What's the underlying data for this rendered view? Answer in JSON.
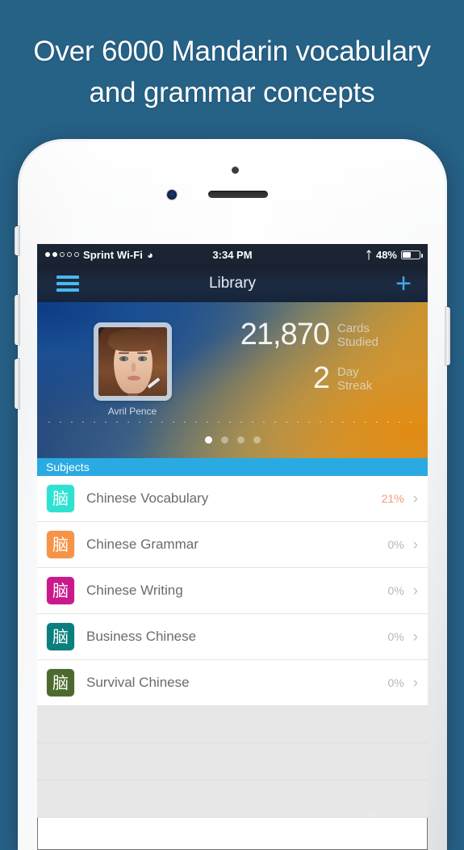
{
  "promo": {
    "line1": "Over 6000 Mandarin vocabulary",
    "line2": "and grammar concepts"
  },
  "status_bar": {
    "carrier": "Sprint Wi-Fi",
    "wifi_icon": "wifi-icon",
    "time": "3:34 PM",
    "bluetooth_icon": "bluetooth-icon",
    "battery_text": "48%",
    "battery_level": 48
  },
  "nav_bar": {
    "menu_icon": "hamburger-menu-icon",
    "title": "Library",
    "add_icon": "plus-icon"
  },
  "profile": {
    "name": "Avril Pence",
    "avatar_alt": "user-avatar-photo",
    "stats": [
      {
        "value": "21,870",
        "label_line1": "Cards",
        "label_line2": "Studied"
      },
      {
        "value": "2",
        "label_line1": "Day",
        "label_line2": "Streak"
      }
    ],
    "page_dots": 4,
    "active_dot": 1
  },
  "subjects_section": {
    "header": "Subjects",
    "header_color": "#2aaae2",
    "items": [
      {
        "icon_glyph": "脑",
        "icon_color": "#2ee2d3",
        "label": "Chinese Vocabulary",
        "percent": "21%",
        "highlight": true,
        "chevron": "›"
      },
      {
        "icon_glyph": "脑",
        "icon_color": "#f79346",
        "label": "Chinese Grammar",
        "percent": "0%",
        "highlight": false,
        "chevron": "›"
      },
      {
        "icon_glyph": "脑",
        "icon_color": "#cb188c",
        "label": "Chinese Writing",
        "percent": "0%",
        "highlight": false,
        "chevron": "›"
      },
      {
        "icon_glyph": "脑",
        "icon_color": "#0b7f80",
        "label": "Business Chinese",
        "percent": "0%",
        "highlight": false,
        "chevron": "›"
      },
      {
        "icon_glyph": "脑",
        "icon_color": "#4d6a2e",
        "label": "Survival Chinese",
        "percent": "0%",
        "highlight": false,
        "chevron": "›"
      }
    ],
    "empty_rows": 3
  },
  "theme": {
    "background": "#266186",
    "accent_blue": "#2aaae2",
    "nav_icon_blue": "#48b8ef",
    "percent_highlight": "#f49a78"
  }
}
